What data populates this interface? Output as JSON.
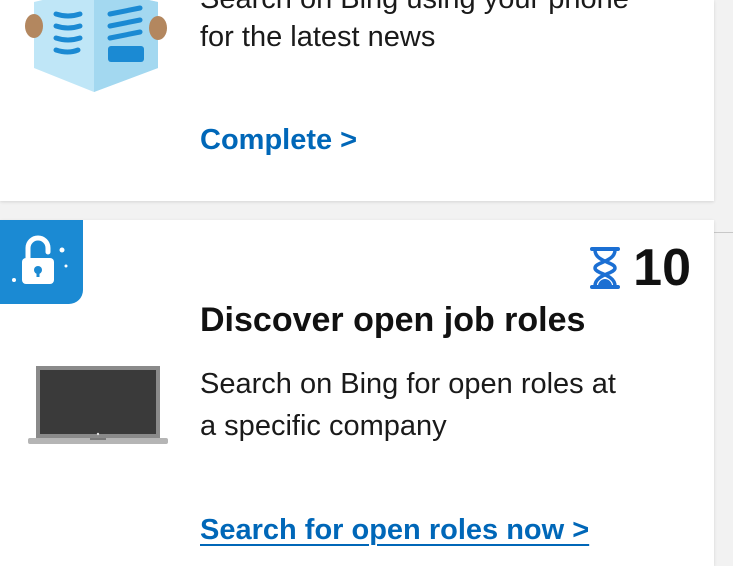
{
  "card1": {
    "description_line1": "Search on Bing using your phone",
    "description_line2": "for the latest news",
    "cta": "Complete >",
    "image_icon": "newspaper-illustration"
  },
  "card2": {
    "badge_icon": "unlock-icon",
    "points_icon": "hourglass-icon",
    "points": "10",
    "title": "Discover open job roles",
    "description_line1": "Search on Bing for open roles at",
    "description_line2": "a specific company",
    "cta": "Search for open roles now >",
    "image_icon": "laptop-illustration"
  },
  "colors": {
    "accent": "#0067b8",
    "badge": "#1b8ad3",
    "background": "#f2f2f2"
  }
}
